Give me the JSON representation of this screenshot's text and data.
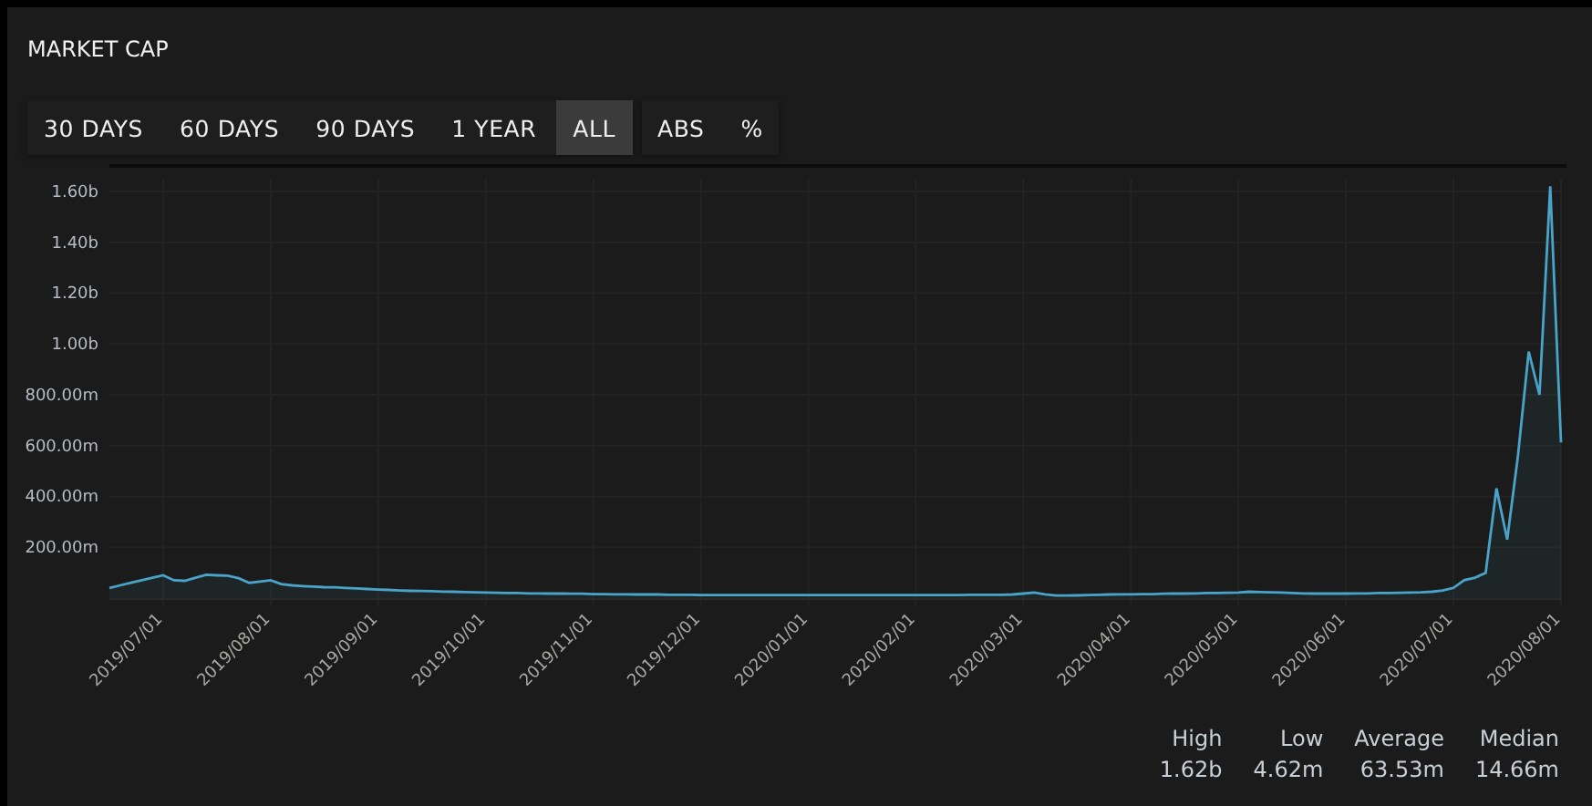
{
  "panel": {
    "title": "MARKET CAP"
  },
  "range_buttons": [
    {
      "label": "30 DAYS",
      "selected": false
    },
    {
      "label": "60 DAYS",
      "selected": false
    },
    {
      "label": "90 DAYS",
      "selected": false
    },
    {
      "label": "1 YEAR",
      "selected": false
    },
    {
      "label": "ALL",
      "selected": true
    }
  ],
  "mode_buttons": [
    {
      "label": "ABS",
      "selected": false
    },
    {
      "label": "%",
      "selected": false
    }
  ],
  "chart_data": {
    "type": "area",
    "categories": [
      null,
      null,
      null,
      null,
      null,
      "2019/07/01",
      null,
      null,
      null,
      null,
      null,
      null,
      null,
      null,
      null,
      "2019/08/01",
      null,
      null,
      null,
      null,
      null,
      null,
      null,
      null,
      null,
      "2019/09/01",
      null,
      null,
      null,
      null,
      null,
      null,
      null,
      null,
      null,
      "2019/10/01",
      null,
      null,
      null,
      null,
      null,
      null,
      null,
      null,
      null,
      "2019/11/01",
      null,
      null,
      null,
      null,
      null,
      null,
      null,
      null,
      null,
      "2019/12/01",
      null,
      null,
      null,
      null,
      null,
      null,
      null,
      null,
      null,
      "2020/01/01",
      null,
      null,
      null,
      null,
      null,
      null,
      null,
      null,
      null,
      "2020/02/01",
      null,
      null,
      null,
      null,
      null,
      null,
      null,
      null,
      null,
      "2020/03/01",
      null,
      null,
      null,
      null,
      null,
      null,
      null,
      null,
      null,
      "2020/04/01",
      null,
      null,
      null,
      null,
      null,
      null,
      null,
      null,
      null,
      "2020/05/01",
      null,
      null,
      null,
      null,
      null,
      null,
      null,
      null,
      null,
      "2020/06/01",
      null,
      null,
      null,
      null,
      null,
      null,
      null,
      null,
      null,
      "2020/07/01",
      null,
      null,
      null,
      null,
      null,
      null,
      null,
      null,
      null,
      "2020/08/01"
    ],
    "series": [
      {
        "color": "#4aa3c8",
        "values": [
          40000000,
          50000000,
          60000000,
          70000000,
          80000000,
          90000000,
          70000000,
          68000000,
          80000000,
          92000000,
          90000000,
          88000000,
          78000000,
          60000000,
          65000000,
          70000000,
          55000000,
          50000000,
          47000000,
          45000000,
          43000000,
          42000000,
          40000000,
          38000000,
          36000000,
          34000000,
          32000000,
          30000000,
          29000000,
          28000000,
          27000000,
          26000000,
          25000000,
          24000000,
          23000000,
          22000000,
          21000000,
          20000000,
          20000000,
          19000000,
          19000000,
          18000000,
          18000000,
          17000000,
          17000000,
          16000000,
          16000000,
          15000000,
          15000000,
          14000000,
          14000000,
          14000000,
          13000000,
          13000000,
          13000000,
          12000000,
          12000000,
          12000000,
          12000000,
          12000000,
          12000000,
          12000000,
          12000000,
          12000000,
          12000000,
          12000000,
          12000000,
          12000000,
          12000000,
          12000000,
          12000000,
          12000000,
          12000000,
          12000000,
          12000000,
          12000000,
          12000000,
          12000000,
          12000000,
          12000000,
          13000000,
          13000000,
          13000000,
          13000000,
          14000000,
          18000000,
          22000000,
          15000000,
          10000000,
          10000000,
          11000000,
          12000000,
          13000000,
          14000000,
          15000000,
          15000000,
          16000000,
          16000000,
          17000000,
          18000000,
          18000000,
          19000000,
          20000000,
          20000000,
          21000000,
          22000000,
          25000000,
          24000000,
          23000000,
          22000000,
          20000000,
          19000000,
          18000000,
          18000000,
          18000000,
          18000000,
          19000000,
          19000000,
          20000000,
          20000000,
          21000000,
          22000000,
          23000000,
          25000000,
          30000000,
          40000000,
          70000000,
          80000000,
          100000000,
          432000000,
          230000000,
          560000000,
          970000000,
          800000000,
          1620000000,
          613000000
        ]
      }
    ],
    "ylim": [
      0,
      1650000000
    ],
    "grid": true,
    "yticks": [
      {
        "value": 200000000,
        "label": "200.00m"
      },
      {
        "value": 400000000,
        "label": "400.00m"
      },
      {
        "value": 600000000,
        "label": "600.00m"
      },
      {
        "value": 800000000,
        "label": "800.00m"
      },
      {
        "value": 1000000000,
        "label": "1.00b"
      },
      {
        "value": 1200000000,
        "label": "1.20b"
      },
      {
        "value": 1400000000,
        "label": "1.40b"
      },
      {
        "value": 1600000000,
        "label": "1.60b"
      }
    ]
  },
  "stats": [
    {
      "label": "High",
      "value": "1.62b"
    },
    {
      "label": "Low",
      "value": "4.62m"
    },
    {
      "label": "Average",
      "value": "63.53m"
    },
    {
      "label": "Median",
      "value": "14.66m"
    }
  ]
}
